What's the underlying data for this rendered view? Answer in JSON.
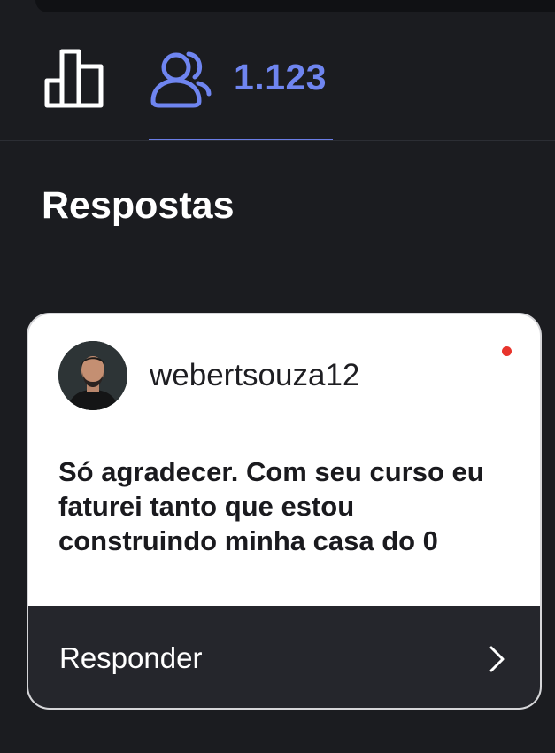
{
  "stats": {
    "audience_count": "1.123",
    "insights_icon": "bar-chart-icon",
    "audience_icon": "people-icon"
  },
  "section": {
    "title": "Respostas"
  },
  "response": {
    "username": "webertsouza12",
    "message": "Só agradecer. Com seu curso eu faturei tanto que estou construindo minha casa do 0",
    "reply_label": "Responder",
    "unread": true,
    "avatar_icon": "avatar-photo",
    "reply_icon": "chevron-right-icon"
  },
  "colors": {
    "background": "#1b1c20",
    "accent": "#6f85f0",
    "unread": "#e8342c",
    "card": "#ffffff",
    "reply_bar": "#25262c"
  }
}
